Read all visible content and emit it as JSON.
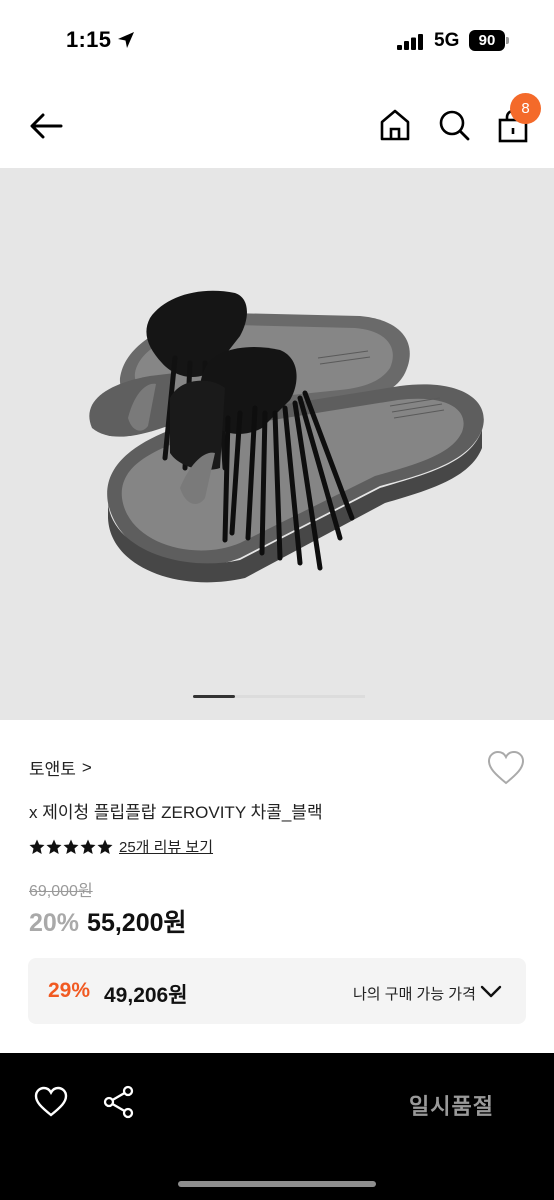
{
  "status_bar": {
    "time": "1:15",
    "network": "5G",
    "battery": "90"
  },
  "header": {
    "cart_count": "8"
  },
  "gallery": {
    "image_description": "black fringe knot flip-flop sandals on grey soles",
    "current_index": 1
  },
  "product": {
    "brand": "토앤토",
    "brand_chevron": ">",
    "name": "x 제이청 플립플랍 ZEROVITY 차콜_블랙",
    "rating_stars": 5,
    "review_link": "25개 리뷰 보기",
    "original_price": "69,000원",
    "discount_rate": "20%",
    "sale_price": "55,200원"
  },
  "my_price": {
    "discount_rate": "29%",
    "price": "49,206원",
    "label": "나의 구매 가능 가격"
  },
  "bottom_bar": {
    "status_label": "일시품절"
  },
  "icons": {
    "back": "back-arrow-icon",
    "home": "home-icon",
    "search": "search-icon",
    "cart": "shopping-bag-icon",
    "wish": "heart-icon",
    "share": "share-icon",
    "expand": "chevron-down-icon"
  },
  "colors": {
    "accent": "#f46a2a",
    "discount": "#f15a22",
    "bottom_bar": "#000000"
  }
}
